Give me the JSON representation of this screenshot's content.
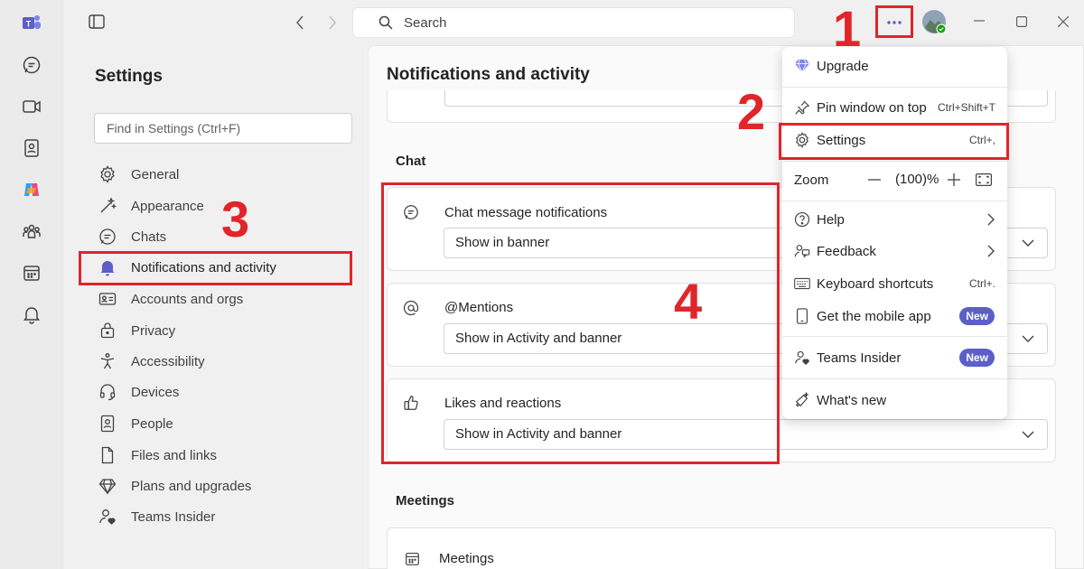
{
  "search": {
    "placeholder": "Search"
  },
  "settings": {
    "title": "Settings",
    "find_placeholder": "Find in Settings (Ctrl+F)",
    "nav": [
      {
        "label": "General",
        "icon": "gear-icon"
      },
      {
        "label": "Appearance",
        "icon": "magic-wand-icon"
      },
      {
        "label": "Chats",
        "icon": "chat-icon"
      },
      {
        "label": "Notifications and activity",
        "icon": "bell-icon"
      },
      {
        "label": "Accounts and orgs",
        "icon": "id-card-icon"
      },
      {
        "label": "Privacy",
        "icon": "lock-icon"
      },
      {
        "label": "Accessibility",
        "icon": "accessibility-icon"
      },
      {
        "label": "Devices",
        "icon": "headset-icon"
      },
      {
        "label": "People",
        "icon": "contact-card-icon"
      },
      {
        "label": "Files and links",
        "icon": "document-icon"
      },
      {
        "label": "Plans and upgrades",
        "icon": "diamond-icon"
      },
      {
        "label": "Teams Insider",
        "icon": "person-heart-icon"
      }
    ]
  },
  "main": {
    "title": "Notifications and activity",
    "chat_section": "Chat",
    "meetings_section": "Meetings",
    "cards": [
      {
        "label": "Chat message notifications",
        "value": "Show in banner",
        "icon": "chat-icon"
      },
      {
        "label": "@Mentions",
        "value": "Show in Activity and banner",
        "icon": "at-icon"
      },
      {
        "label": "Likes and reactions",
        "value": "Show in Activity and banner",
        "icon": "thumbs-up-icon"
      }
    ],
    "meetings_card": {
      "label": "Meetings",
      "icon": "calendar-icon"
    }
  },
  "menu": {
    "upgrade": "Upgrade",
    "pin": {
      "label": "Pin window on top",
      "shortcut": "Ctrl+Shift+T"
    },
    "settings": {
      "label": "Settings",
      "shortcut": "Ctrl+,"
    },
    "zoom": {
      "label": "Zoom",
      "value": "(100)%"
    },
    "help": "Help",
    "feedback": "Feedback",
    "keyboard": {
      "label": "Keyboard shortcuts",
      "shortcut": "Ctrl+."
    },
    "mobile": {
      "label": "Get the mobile app",
      "badge": "New"
    },
    "insider": {
      "label": "Teams Insider",
      "badge": "New"
    },
    "whats_new": "What's new"
  },
  "annotations": [
    "1",
    "2",
    "3",
    "4"
  ],
  "colors": {
    "accent": "#5b5fc7",
    "annotation": "#e0252b"
  }
}
